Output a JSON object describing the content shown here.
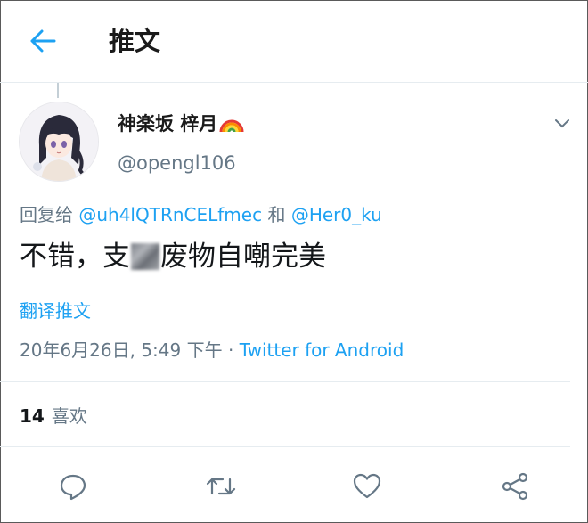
{
  "header": {
    "title": "推文",
    "back_icon": "arrow-left-icon",
    "accent_color": "#1da1f2"
  },
  "tweet": {
    "display_name": "神楽坂 梓月",
    "name_emoji_icon": "rainbow-icon",
    "handle": "@opengl106",
    "reply_prefix": "回复给",
    "reply_mention_1": "@uh4lQTRnCELfmec",
    "reply_joiner": "和",
    "reply_mention_2": "@Her0_ku",
    "text_before": "不错，支",
    "text_after": "废物自嘲完美",
    "translate_label": "翻译推文",
    "timestamp": "20年6月26日, 5:49 下午",
    "separator": "·",
    "source": "Twitter for Android",
    "likes_count": "14",
    "likes_label": "喜欢"
  },
  "actions": {
    "reply_icon": "comment-icon",
    "retweet_icon": "retweet-icon",
    "like_icon": "heart-icon",
    "share_icon": "share-icon"
  }
}
